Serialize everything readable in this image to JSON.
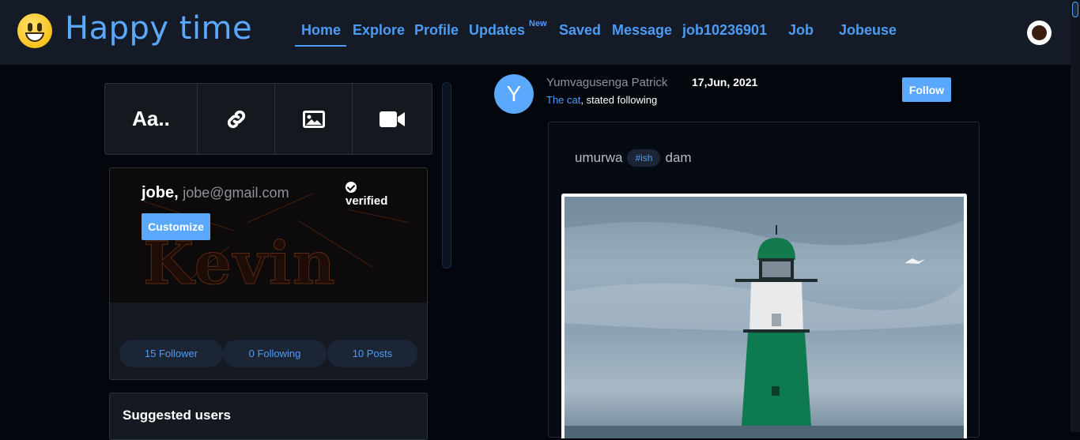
{
  "header": {
    "brand": "Happy time",
    "nav": [
      {
        "label": "Home",
        "active": true
      },
      {
        "label": "Explore"
      },
      {
        "label": "Profile"
      },
      {
        "label": "Updates",
        "badge": "New"
      },
      {
        "label": "Saved"
      },
      {
        "label": "Message"
      },
      {
        "label": "job10236901"
      },
      {
        "label": "Job"
      },
      {
        "label": "Jobeuse"
      }
    ],
    "accent": "#4c9cf5"
  },
  "composer": {
    "text_label": "Aa..",
    "icons": [
      "link-icon",
      "image-icon",
      "video-camera-icon"
    ]
  },
  "profile": {
    "name": "jobe,",
    "email": "jobe@gmail.com",
    "verified_label": "verified",
    "customize_label": "Customize",
    "cover_text": "Kevin",
    "stats": {
      "followers": "15 Follower",
      "following": "0 Following",
      "posts": "10 Posts"
    }
  },
  "suggested": {
    "title": "Suggested users"
  },
  "post": {
    "avatar_letter": "Y",
    "author": "Yumvagusenga Patrick",
    "date": "17,Jun, 2021",
    "sub_link": "The cat",
    "sub_text": ", stated following",
    "follow_label": "Follow",
    "text_before": "umurwa",
    "hashtag": "#ish",
    "text_after": "dam"
  }
}
